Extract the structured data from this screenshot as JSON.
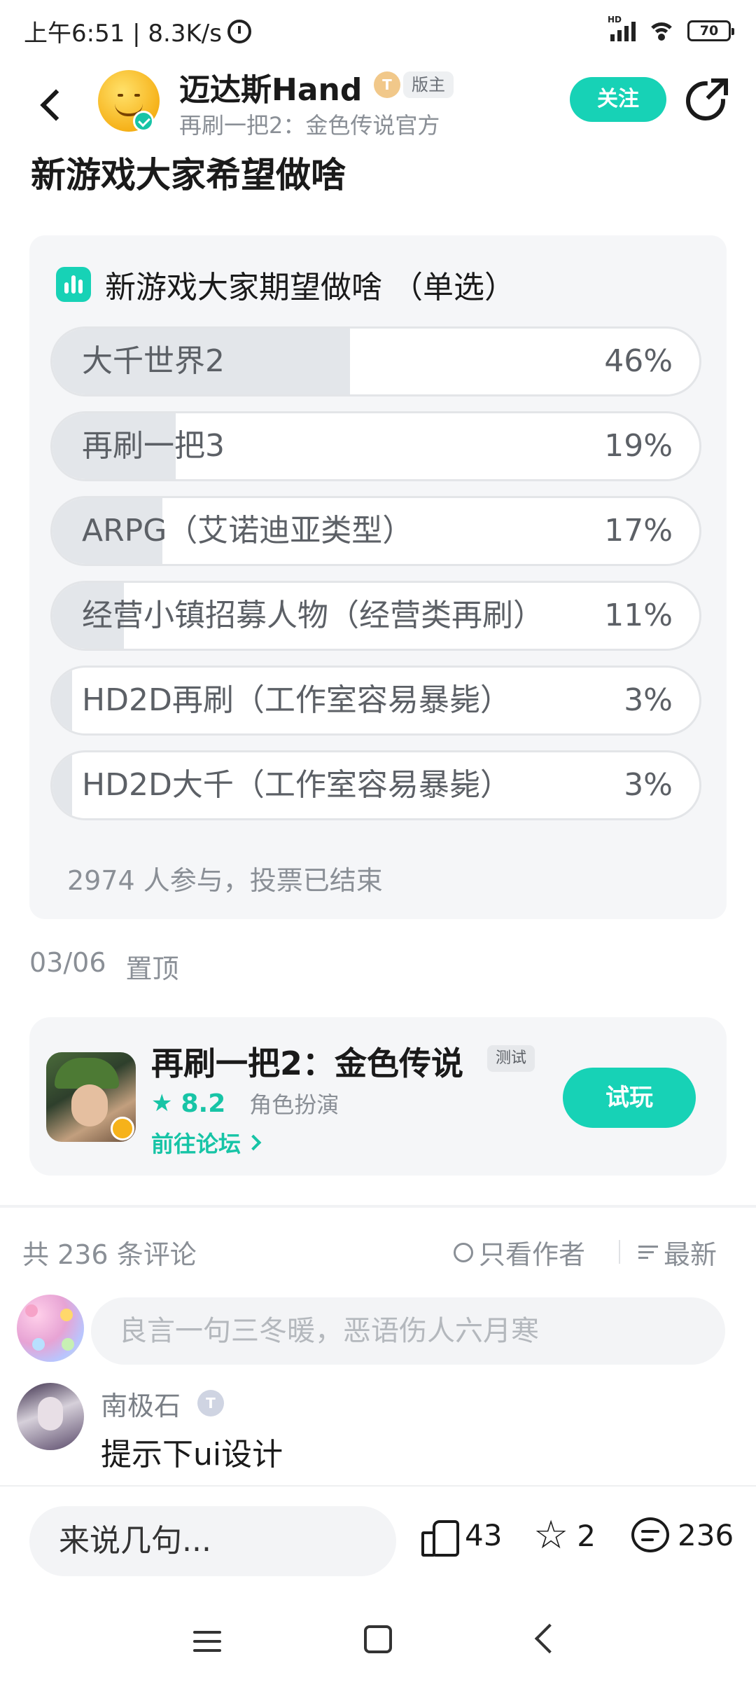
{
  "status_bar": {
    "time_speed": "上午6:51 | 8.3K/s",
    "battery": "70",
    "signal_label": "HD"
  },
  "header": {
    "author_name": "迈达斯Hand",
    "level_badge": "T",
    "role_badge": "版主",
    "subtitle": "再刷一把2：金色传说官方",
    "follow_label": "关注"
  },
  "post": {
    "title": "新游戏大家希望做啥",
    "date": "03/06",
    "pinned_label": "置顶"
  },
  "poll": {
    "title": "新游戏大家期望做啥 （单选）",
    "options": [
      {
        "label": "大千世界2",
        "percent_label": "46%",
        "fraction": 0.46
      },
      {
        "label": "再刷一把3",
        "percent_label": "19%",
        "fraction": 0.19
      },
      {
        "label": "ARPG（艾诺迪亚类型）",
        "percent_label": "17%",
        "fraction": 0.17
      },
      {
        "label": "经营小镇招募人物（经营类再刷）",
        "percent_label": "11%",
        "fraction": 0.11
      },
      {
        "label": "HD2D再刷（工作室容易暴毙）",
        "percent_label": "3%",
        "fraction": 0.03
      },
      {
        "label": "HD2D大千（工作室容易暴毙）",
        "percent_label": "3%",
        "fraction": 0.03
      }
    ],
    "footer": "2974 人参与，投票已结束"
  },
  "game_card": {
    "name": "再刷一把2：金色传说",
    "tag": "测试",
    "rating": "8.2",
    "genre": "角色扮演",
    "forum_link": "前往论坛",
    "play_label": "试玩"
  },
  "comments": {
    "count_label": "共 236 条评论",
    "filter_author": "只看作者",
    "sort_label": "最新",
    "input_placeholder": "良言一句三冬暖，恶语伤人六月寒",
    "items": [
      {
        "name": "南极石",
        "level": "T",
        "text": "提示下ui设计"
      }
    ]
  },
  "bottom_bar": {
    "reply_placeholder": "来说几句...",
    "likes": "43",
    "favorites": "2",
    "comments": "236"
  },
  "colors": {
    "accent": "#17d2b6",
    "accent_text": "#17c4a6",
    "poll_fill": "#e3e6ea",
    "card_bg": "#f5f6f8"
  }
}
